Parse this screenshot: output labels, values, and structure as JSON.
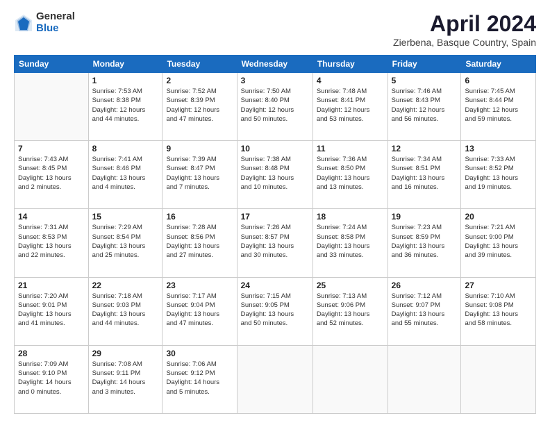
{
  "logo": {
    "general": "General",
    "blue": "Blue"
  },
  "title": "April 2024",
  "subtitle": "Zierbena, Basque Country, Spain",
  "weekdays": [
    "Sunday",
    "Monday",
    "Tuesday",
    "Wednesday",
    "Thursday",
    "Friday",
    "Saturday"
  ],
  "weeks": [
    [
      {
        "day": "",
        "info": ""
      },
      {
        "day": "1",
        "info": "Sunrise: 7:53 AM\nSunset: 8:38 PM\nDaylight: 12 hours\nand 44 minutes."
      },
      {
        "day": "2",
        "info": "Sunrise: 7:52 AM\nSunset: 8:39 PM\nDaylight: 12 hours\nand 47 minutes."
      },
      {
        "day": "3",
        "info": "Sunrise: 7:50 AM\nSunset: 8:40 PM\nDaylight: 12 hours\nand 50 minutes."
      },
      {
        "day": "4",
        "info": "Sunrise: 7:48 AM\nSunset: 8:41 PM\nDaylight: 12 hours\nand 53 minutes."
      },
      {
        "day": "5",
        "info": "Sunrise: 7:46 AM\nSunset: 8:43 PM\nDaylight: 12 hours\nand 56 minutes."
      },
      {
        "day": "6",
        "info": "Sunrise: 7:45 AM\nSunset: 8:44 PM\nDaylight: 12 hours\nand 59 minutes."
      }
    ],
    [
      {
        "day": "7",
        "info": "Sunrise: 7:43 AM\nSunset: 8:45 PM\nDaylight: 13 hours\nand 2 minutes."
      },
      {
        "day": "8",
        "info": "Sunrise: 7:41 AM\nSunset: 8:46 PM\nDaylight: 13 hours\nand 4 minutes."
      },
      {
        "day": "9",
        "info": "Sunrise: 7:39 AM\nSunset: 8:47 PM\nDaylight: 13 hours\nand 7 minutes."
      },
      {
        "day": "10",
        "info": "Sunrise: 7:38 AM\nSunset: 8:48 PM\nDaylight: 13 hours\nand 10 minutes."
      },
      {
        "day": "11",
        "info": "Sunrise: 7:36 AM\nSunset: 8:50 PM\nDaylight: 13 hours\nand 13 minutes."
      },
      {
        "day": "12",
        "info": "Sunrise: 7:34 AM\nSunset: 8:51 PM\nDaylight: 13 hours\nand 16 minutes."
      },
      {
        "day": "13",
        "info": "Sunrise: 7:33 AM\nSunset: 8:52 PM\nDaylight: 13 hours\nand 19 minutes."
      }
    ],
    [
      {
        "day": "14",
        "info": "Sunrise: 7:31 AM\nSunset: 8:53 PM\nDaylight: 13 hours\nand 22 minutes."
      },
      {
        "day": "15",
        "info": "Sunrise: 7:29 AM\nSunset: 8:54 PM\nDaylight: 13 hours\nand 25 minutes."
      },
      {
        "day": "16",
        "info": "Sunrise: 7:28 AM\nSunset: 8:56 PM\nDaylight: 13 hours\nand 27 minutes."
      },
      {
        "day": "17",
        "info": "Sunrise: 7:26 AM\nSunset: 8:57 PM\nDaylight: 13 hours\nand 30 minutes."
      },
      {
        "day": "18",
        "info": "Sunrise: 7:24 AM\nSunset: 8:58 PM\nDaylight: 13 hours\nand 33 minutes."
      },
      {
        "day": "19",
        "info": "Sunrise: 7:23 AM\nSunset: 8:59 PM\nDaylight: 13 hours\nand 36 minutes."
      },
      {
        "day": "20",
        "info": "Sunrise: 7:21 AM\nSunset: 9:00 PM\nDaylight: 13 hours\nand 39 minutes."
      }
    ],
    [
      {
        "day": "21",
        "info": "Sunrise: 7:20 AM\nSunset: 9:01 PM\nDaylight: 13 hours\nand 41 minutes."
      },
      {
        "day": "22",
        "info": "Sunrise: 7:18 AM\nSunset: 9:03 PM\nDaylight: 13 hours\nand 44 minutes."
      },
      {
        "day": "23",
        "info": "Sunrise: 7:17 AM\nSunset: 9:04 PM\nDaylight: 13 hours\nand 47 minutes."
      },
      {
        "day": "24",
        "info": "Sunrise: 7:15 AM\nSunset: 9:05 PM\nDaylight: 13 hours\nand 50 minutes."
      },
      {
        "day": "25",
        "info": "Sunrise: 7:13 AM\nSunset: 9:06 PM\nDaylight: 13 hours\nand 52 minutes."
      },
      {
        "day": "26",
        "info": "Sunrise: 7:12 AM\nSunset: 9:07 PM\nDaylight: 13 hours\nand 55 minutes."
      },
      {
        "day": "27",
        "info": "Sunrise: 7:10 AM\nSunset: 9:08 PM\nDaylight: 13 hours\nand 58 minutes."
      }
    ],
    [
      {
        "day": "28",
        "info": "Sunrise: 7:09 AM\nSunset: 9:10 PM\nDaylight: 14 hours\nand 0 minutes."
      },
      {
        "day": "29",
        "info": "Sunrise: 7:08 AM\nSunset: 9:11 PM\nDaylight: 14 hours\nand 3 minutes."
      },
      {
        "day": "30",
        "info": "Sunrise: 7:06 AM\nSunset: 9:12 PM\nDaylight: 14 hours\nand 5 minutes."
      },
      {
        "day": "",
        "info": ""
      },
      {
        "day": "",
        "info": ""
      },
      {
        "day": "",
        "info": ""
      },
      {
        "day": "",
        "info": ""
      }
    ]
  ]
}
